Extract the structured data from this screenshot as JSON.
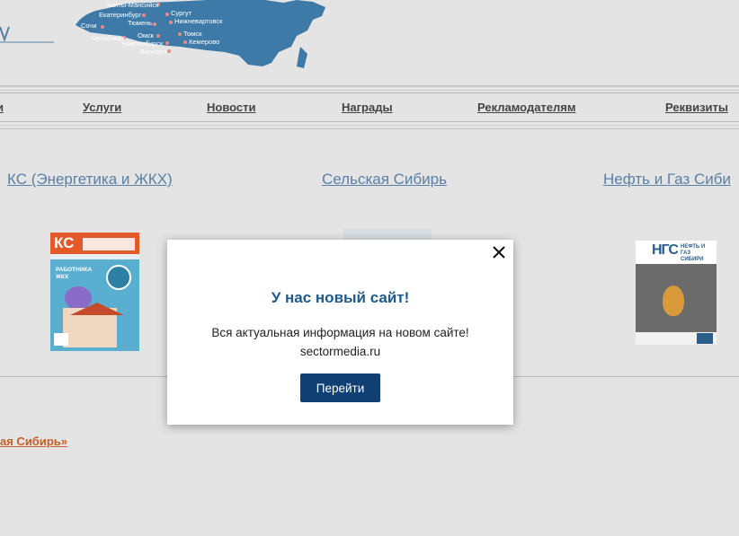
{
  "header": {
    "map_cities": [
      "Ханты-Мансийск",
      "Сургут",
      "Екатеринбург",
      "Нижневартовск",
      "Тюмень",
      "Сочи",
      "Омск",
      "Томск",
      "Челябинск",
      "Новосибирск",
      "Кемерово",
      "Барнаул"
    ]
  },
  "nav": {
    "items": [
      {
        "label": "Услуги"
      },
      {
        "label": "Новости"
      },
      {
        "label": "Награды"
      },
      {
        "label": "Рекламодателям"
      },
      {
        "label": "Реквизиты"
      }
    ]
  },
  "magazines": [
    {
      "title": "КС (Энергетика и ЖКХ)",
      "cover_logo": "КС",
      "cover_text": "РАБОТНИКА ЖКХ"
    },
    {
      "title": "Сельская Сибирь"
    },
    {
      "title": "Нефть и Газ Сиби",
      "cover_logo": "НГС",
      "cover_text": "НЕФТЬ И ГАЗ СИБИРИ"
    }
  ],
  "footer_link": "ая Сибирь»",
  "modal": {
    "title": "У нас новый сайт!",
    "line1": "Вся актуальная информация на новом сайте!",
    "line2": "sectormedia.ru",
    "button": "Перейти"
  },
  "colors": {
    "accent": "#0f3f73",
    "link": "#5a7fa6",
    "map": "#3e7aa8",
    "orange_link": "#c0622a"
  }
}
